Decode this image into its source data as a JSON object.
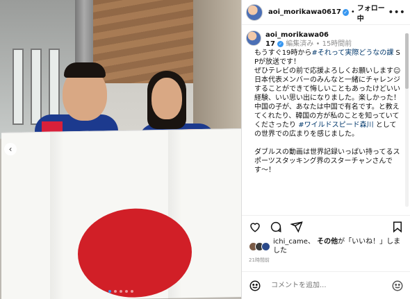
{
  "header": {
    "username": "aoi_morikawa0617",
    "separator": "•",
    "follow_label": "フォロー中",
    "more_label": "•••"
  },
  "caption": {
    "username": "aoi_morikawa06\n17",
    "edited": "編集済み",
    "separator": "•",
    "time": "15時間前",
    "lines": [
      "もうすぐ19時から",
      "#それって実際どうなの課",
      " SPが放送です！\nぜひテレビの前で応援よろしくお願いします☺︎\n日本代表メンバーのみんなと一緒にチャレンジすることができて悔しいこともあったけどいい経験、いい思い出になりました。楽しかった！\n中国の子が、あなたは中国で有名です。と教えてくれたり、韓国の方が私のことを知っていてくださったり ",
      "#ワイルドスピード森川",
      " としての世界での広まりを感じました。\n\nダブルスの動画は世界記録いっぱい持ってるスポーツスタッキング界のスターチャンさんです〜！"
    ]
  },
  "likes": {
    "user": "ichi_came、",
    "others": "その他",
    "suffix": "が「いいね！」しました"
  },
  "time_ago": "21時間前",
  "comment": {
    "placeholder": "コメントを追加..."
  },
  "icons": [
    "heart-icon",
    "comment-icon",
    "share-icon",
    "bookmark-icon",
    "emoji-icon",
    "more-icon",
    "verified-icon",
    "chevron-left-icon"
  ],
  "carousel": {
    "count": 5,
    "active": 1
  },
  "colors": {
    "link": "#00376b",
    "verified": "#3897f0",
    "flag_red": "#d11f27"
  }
}
